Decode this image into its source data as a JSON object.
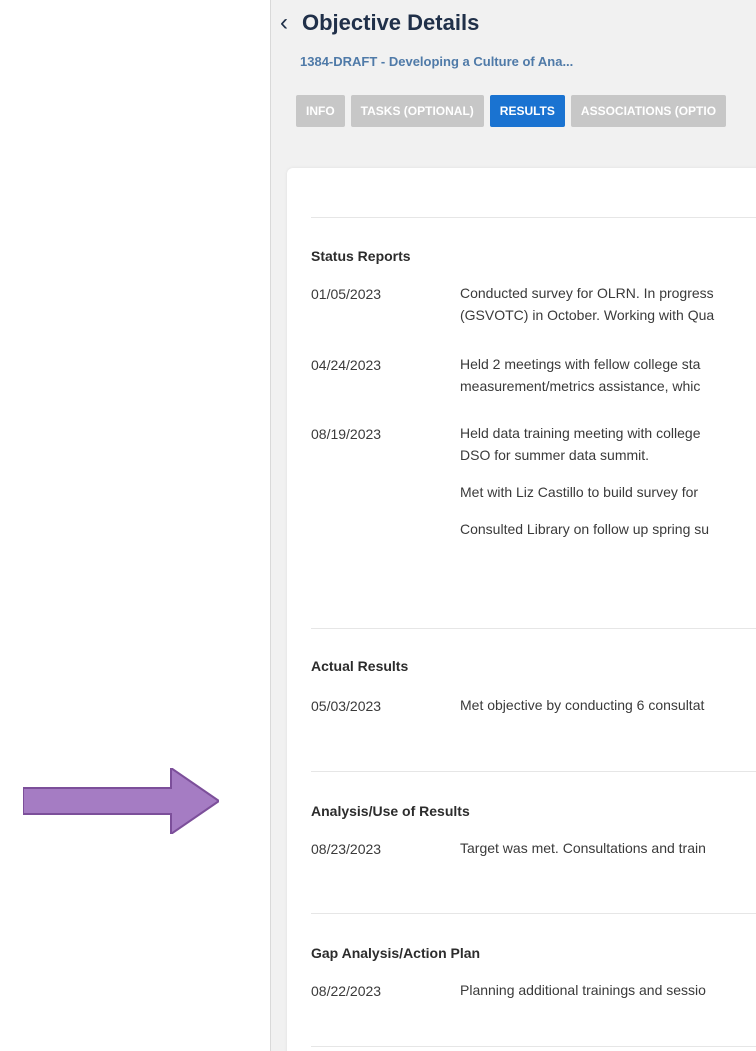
{
  "annotation": {
    "arrow_color": "#a57cc3",
    "arrow_outline": "#7c4f9a"
  },
  "page": {
    "back_icon": "chevron-left-icon",
    "title": "Objective Details",
    "breadcrumb": "1384-DRAFT - Developing a Culture of Ana..."
  },
  "tabs": [
    {
      "label": "INFO",
      "active": false
    },
    {
      "label": "TASKS (OPTIONAL)",
      "active": false
    },
    {
      "label": "RESULTS",
      "active": true
    },
    {
      "label": "ASSOCIATIONS (OPTIO",
      "active": false
    }
  ],
  "sections": {
    "status_reports": {
      "title": "Status Reports",
      "entries": [
        {
          "date": "01/05/2023",
          "lines": [
            "Conducted survey for OLRN. In progress",
            "(GSVOTC) in October. Working with Qua"
          ]
        },
        {
          "date": "04/24/2023",
          "lines": [
            "Held 2 meetings with fellow college sta",
            "measurement/metrics assistance, whic"
          ]
        },
        {
          "date": "08/19/2023",
          "lines": [
            "Held data training meeting with college",
            "DSO for summer data summit.",
            "Met with Liz Castillo to build survey for",
            "Consulted Library on follow up spring su"
          ]
        }
      ]
    },
    "actual_results": {
      "title": "Actual Results",
      "entries": [
        {
          "date": "05/03/2023",
          "text": "Met objective by conducting 6 consultat"
        }
      ]
    },
    "analysis": {
      "title": "Analysis/Use of Results",
      "entries": [
        {
          "date": "08/23/2023",
          "text": "Target was met. Consultations and train"
        }
      ]
    },
    "gap_analysis": {
      "title": "Gap Analysis/Action Plan",
      "entries": [
        {
          "date": "08/22/2023",
          "text": "Planning additional trainings and sessio"
        }
      ]
    }
  },
  "colors": {
    "title": "#203049",
    "breadcrumb": "#4f7aa8",
    "tab_inactive": "#c7c7c7",
    "tab_active": "#1a73d1",
    "panel_bg": "#f1f1f1"
  }
}
